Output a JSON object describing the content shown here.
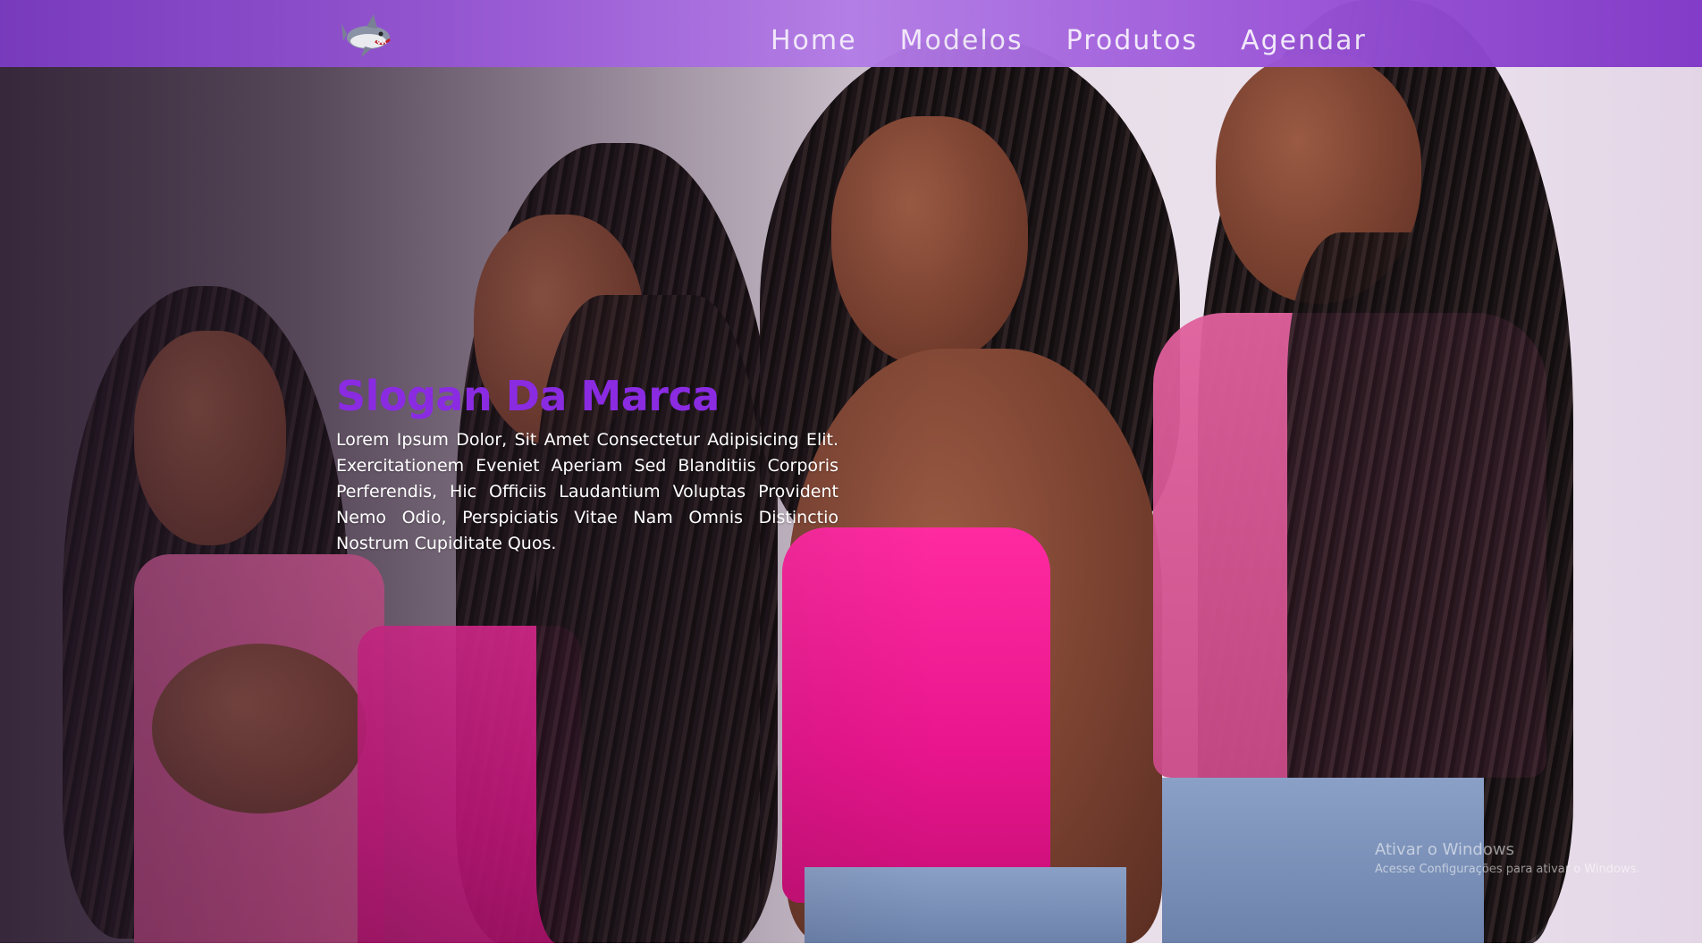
{
  "nav": {
    "logo_name": "shark-logo",
    "links": [
      {
        "label": "Home"
      },
      {
        "label": "Modelos"
      },
      {
        "label": "Produtos"
      },
      {
        "label": "Agendar"
      }
    ]
  },
  "hero": {
    "slogan": "Slogan Da Marca",
    "description": "Lorem Ipsum Dolor, Sit Amet Consectetur Adipisicing Elit. Exercitationem Eveniet Aperiam Sed Blanditiis Corporis Perferendis, Hic Officiis Laudantium Voluptas Provident Nemo Odio, Perspiciatis Vitae Nam Omnis Distinctio Nostrum Cupiditate Quos."
  },
  "watermark": {
    "title": "Ativar o Windows",
    "subtitle": "Acesse Configurações para ativar o Windows."
  },
  "colors": {
    "navbar": "#9a5ad6",
    "slogan": "#8a2be2",
    "description_text": "#ffffff"
  }
}
